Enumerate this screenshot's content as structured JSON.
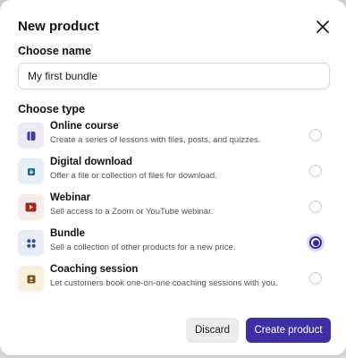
{
  "modal": {
    "title": "New product",
    "close_icon": "close-icon"
  },
  "name_section": {
    "label": "Choose name",
    "value": "My first bundle"
  },
  "type_section": {
    "label": "Choose type",
    "selected": "Bundle",
    "options": [
      {
        "title": "Online course",
        "description": "Create a series of lessons with files, posts, and quizzes.",
        "icon": "course-icon",
        "icon_color": "#3d3aa8",
        "icon_bg": "#ebeaf7"
      },
      {
        "title": "Digital download",
        "description": "Offer a file or collection of files for download.",
        "icon": "download-icon",
        "icon_color": "#1f6a8a",
        "icon_bg": "#e5f0f5"
      },
      {
        "title": "Webinar",
        "description": "Sell access to a Zoom or YouTube webinar.",
        "icon": "video-play-icon",
        "icon_color": "#a52a1e",
        "icon_bg": "#f8ebe9"
      },
      {
        "title": "Bundle",
        "description": "Sell a collection of other products for a new price.",
        "icon": "grid-icon",
        "icon_color": "#2a4fa8",
        "icon_bg": "#e7ecf7"
      },
      {
        "title": "Coaching session",
        "description": "Let customers book one-on-one coaching sessions with you.",
        "icon": "person-card-icon",
        "icon_color": "#7a5414",
        "icon_bg": "#f8efe0"
      }
    ]
  },
  "actions": {
    "discard_label": "Discard",
    "create_label": "Create product"
  },
  "colors": {
    "accent": "#3e2fa6"
  }
}
